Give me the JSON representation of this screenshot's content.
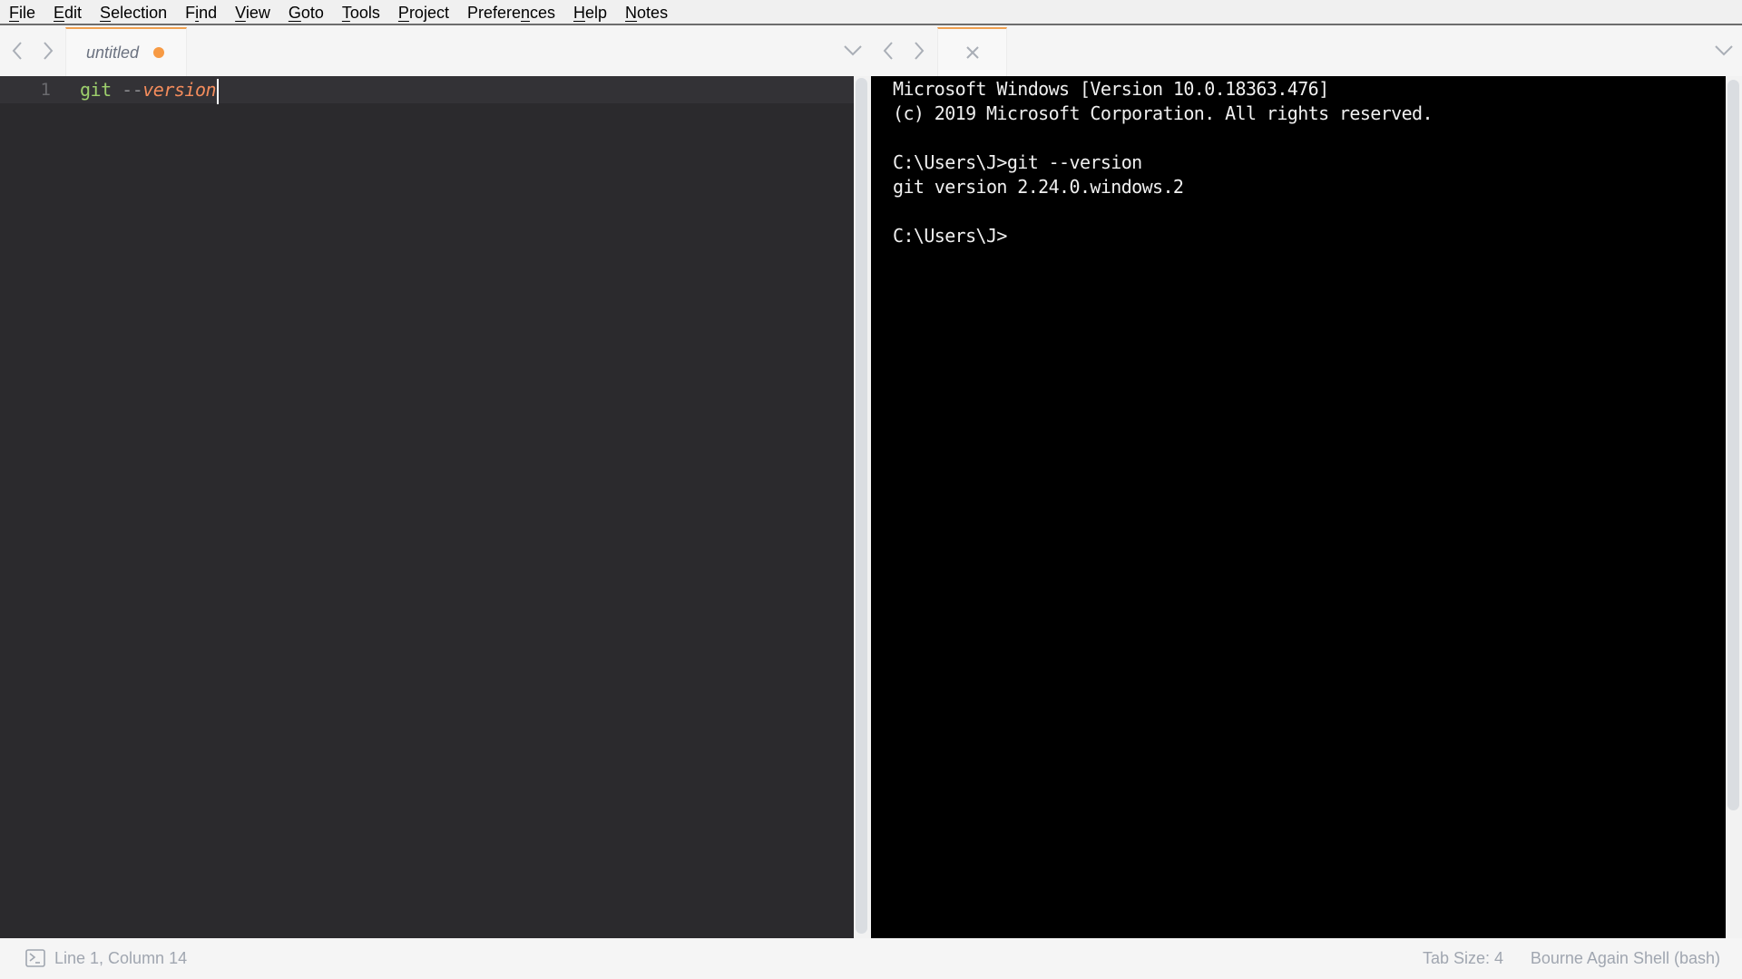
{
  "menu": {
    "items": [
      {
        "label": "File",
        "key": "F",
        "rest": "ile"
      },
      {
        "label": "Edit",
        "key": "E",
        "rest": "dit"
      },
      {
        "label": "Selection",
        "key": "S",
        "rest": "election"
      },
      {
        "label": "Find",
        "pre": "F",
        "key": "i",
        "rest": "nd"
      },
      {
        "label": "View",
        "key": "V",
        "rest": "iew"
      },
      {
        "label": "Goto",
        "key": "G",
        "rest": "oto"
      },
      {
        "label": "Tools",
        "key": "T",
        "rest": "ools"
      },
      {
        "label": "Project",
        "key": "P",
        "rest": "roject"
      },
      {
        "label": "Preferences",
        "pre": "Prefere",
        "key": "n",
        "rest": "ces"
      },
      {
        "label": "Help",
        "key": "H",
        "rest": "elp"
      },
      {
        "label": "Notes",
        "key": "N",
        "rest": "otes"
      }
    ]
  },
  "left_pane": {
    "tab": {
      "label": "untitled",
      "dirty": true
    },
    "dirty_color": "#f79a44",
    "active_tab_accent": "#f0a050",
    "editor": {
      "lines": [
        {
          "number": "1",
          "tokens": {
            "command": "git",
            "dashes": " --",
            "argument": "version"
          }
        }
      ],
      "caret_after_col": 14
    }
  },
  "right_pane": {
    "tab": {
      "label": "",
      "close_icon": "close-icon"
    },
    "terminal": {
      "lines": [
        "Microsoft Windows [Version 10.0.18363.476]",
        "(c) 2019 Microsoft Corporation. All rights reserved.",
        "",
        "C:\\Users\\J>git --version",
        "git version 2.24.0.windows.2",
        "",
        "C:\\Users\\J>"
      ]
    }
  },
  "status": {
    "position": "Line 1, Column 14",
    "tab_size": "Tab Size: 4",
    "syntax": "Bourne Again Shell (bash)",
    "console_icon": "console-icon"
  }
}
